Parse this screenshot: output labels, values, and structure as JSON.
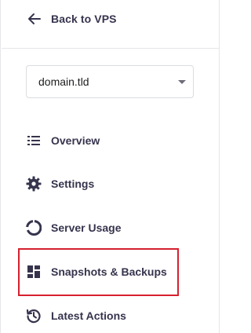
{
  "header": {
    "back_label": "Back to VPS",
    "back_icon": "arrow-left-icon"
  },
  "domain_select": {
    "value": "domain.tld",
    "caret_icon": "caret-down-icon"
  },
  "nav": {
    "items": [
      {
        "label": "Overview",
        "icon": "list-icon"
      },
      {
        "label": "Settings",
        "icon": "gear-icon"
      },
      {
        "label": "Server Usage",
        "icon": "donut-chart-icon"
      },
      {
        "label": "Snapshots & Backups",
        "icon": "dashboard-grid-icon"
      },
      {
        "label": "Latest Actions",
        "icon": "history-icon"
      }
    ]
  },
  "colors": {
    "text": "#36344d",
    "icon": "#36344d",
    "border": "#e6e6ea",
    "highlight": "#d6202f"
  }
}
